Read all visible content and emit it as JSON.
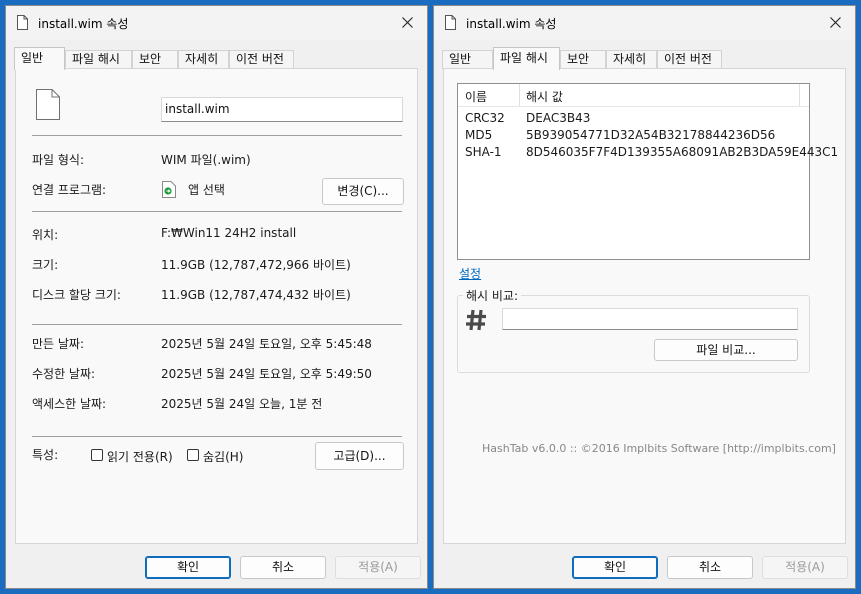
{
  "dialog1": {
    "title": "install.wim 속성",
    "tabs": [
      "일반",
      "파일 해시",
      "보안",
      "자세히",
      "이전 버전"
    ],
    "filename": "install.wim",
    "file_type_label": "파일 형식:",
    "file_type_value": "WIM 파일(.wim)",
    "opens_with_label": "연결 프로그램:",
    "opens_with_value": "앱 선택",
    "change_button": "변경(C)...",
    "location_label": "위치:",
    "location_value": "F:₩Win11 24H2 install",
    "size_label": "크기:",
    "size_value": "11.9GB (12,787,472,966 바이트)",
    "disk_size_label": "디스크 할당 크기:",
    "disk_size_value": "11.9GB (12,787,474,432 바이트)",
    "created_label": "만든 날짜:",
    "created_value": "2025년 5월 24일 토요일, 오후 5:45:48",
    "modified_label": "수정한 날짜:",
    "modified_value": "2025년 5월 24일 토요일, 오후 5:49:50",
    "accessed_label": "액세스한 날짜:",
    "accessed_value": "2025년 5월 24일 오늘, 1분 전",
    "attributes_label": "특성:",
    "readonly_label": "읽기 전용(R)",
    "hidden_label": "숨김(H)",
    "advanced_button": "고급(D)...",
    "ok_button": "확인",
    "cancel_button": "취소",
    "apply_button": "적용(A)"
  },
  "dialog2": {
    "title": "install.wim 속성",
    "tabs": [
      "일반",
      "파일 해시",
      "보안",
      "자세히",
      "이전 버전"
    ],
    "col_name": "이름",
    "col_hash": "해시 값",
    "hashes": [
      {
        "name": "CRC32",
        "value": "DEAC3B43"
      },
      {
        "name": "MD5",
        "value": "5B939054771D32A54B32178844236D56"
      },
      {
        "name": "SHA-1",
        "value": "8D546035F7F4D139355A68091AB2B3DA59E443C1"
      }
    ],
    "settings_link": "설정",
    "compare_group": "해시 비교:",
    "compare_value": "",
    "compare_file_button": "파일 비교...",
    "footer": "HashTab v6.0.0 :: ©2016 Implbits Software [http://implbits.com]",
    "ok_button": "확인",
    "cancel_button": "취소",
    "apply_button": "적용(A)"
  },
  "colors": {
    "accent": "#0f6cbd",
    "link": "#0067c0",
    "desktop": "#1a6cc0"
  },
  "icons": [
    "document-icon",
    "close-icon",
    "file-icon",
    "app-icon",
    "hash-icon"
  ]
}
